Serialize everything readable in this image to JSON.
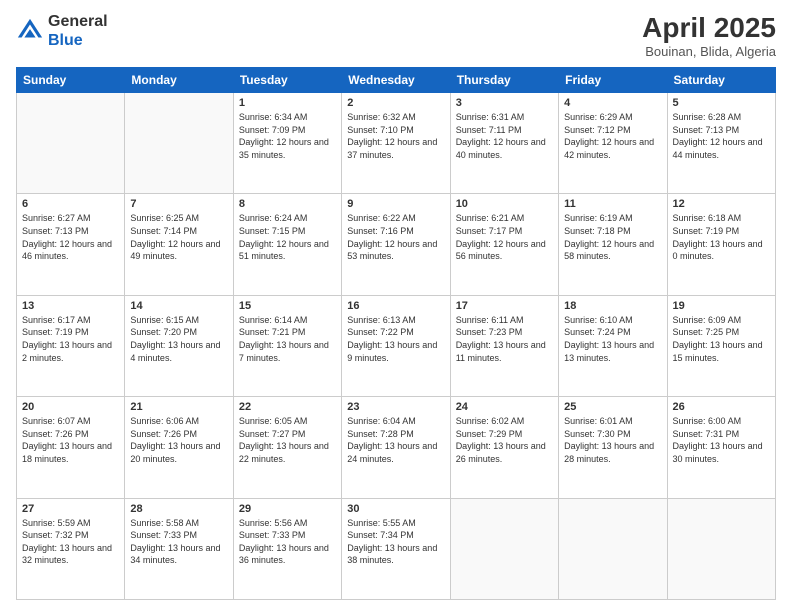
{
  "header": {
    "logo_line1": "General",
    "logo_line2": "Blue",
    "title": "April 2025",
    "subtitle": "Bouinan, Blida, Algeria"
  },
  "days_of_week": [
    "Sunday",
    "Monday",
    "Tuesday",
    "Wednesday",
    "Thursday",
    "Friday",
    "Saturday"
  ],
  "weeks": [
    [
      {
        "day": "",
        "info": ""
      },
      {
        "day": "",
        "info": ""
      },
      {
        "day": "1",
        "info": "Sunrise: 6:34 AM\nSunset: 7:09 PM\nDaylight: 12 hours and 35 minutes."
      },
      {
        "day": "2",
        "info": "Sunrise: 6:32 AM\nSunset: 7:10 PM\nDaylight: 12 hours and 37 minutes."
      },
      {
        "day": "3",
        "info": "Sunrise: 6:31 AM\nSunset: 7:11 PM\nDaylight: 12 hours and 40 minutes."
      },
      {
        "day": "4",
        "info": "Sunrise: 6:29 AM\nSunset: 7:12 PM\nDaylight: 12 hours and 42 minutes."
      },
      {
        "day": "5",
        "info": "Sunrise: 6:28 AM\nSunset: 7:13 PM\nDaylight: 12 hours and 44 minutes."
      }
    ],
    [
      {
        "day": "6",
        "info": "Sunrise: 6:27 AM\nSunset: 7:13 PM\nDaylight: 12 hours and 46 minutes."
      },
      {
        "day": "7",
        "info": "Sunrise: 6:25 AM\nSunset: 7:14 PM\nDaylight: 12 hours and 49 minutes."
      },
      {
        "day": "8",
        "info": "Sunrise: 6:24 AM\nSunset: 7:15 PM\nDaylight: 12 hours and 51 minutes."
      },
      {
        "day": "9",
        "info": "Sunrise: 6:22 AM\nSunset: 7:16 PM\nDaylight: 12 hours and 53 minutes."
      },
      {
        "day": "10",
        "info": "Sunrise: 6:21 AM\nSunset: 7:17 PM\nDaylight: 12 hours and 56 minutes."
      },
      {
        "day": "11",
        "info": "Sunrise: 6:19 AM\nSunset: 7:18 PM\nDaylight: 12 hours and 58 minutes."
      },
      {
        "day": "12",
        "info": "Sunrise: 6:18 AM\nSunset: 7:19 PM\nDaylight: 13 hours and 0 minutes."
      }
    ],
    [
      {
        "day": "13",
        "info": "Sunrise: 6:17 AM\nSunset: 7:19 PM\nDaylight: 13 hours and 2 minutes."
      },
      {
        "day": "14",
        "info": "Sunrise: 6:15 AM\nSunset: 7:20 PM\nDaylight: 13 hours and 4 minutes."
      },
      {
        "day": "15",
        "info": "Sunrise: 6:14 AM\nSunset: 7:21 PM\nDaylight: 13 hours and 7 minutes."
      },
      {
        "day": "16",
        "info": "Sunrise: 6:13 AM\nSunset: 7:22 PM\nDaylight: 13 hours and 9 minutes."
      },
      {
        "day": "17",
        "info": "Sunrise: 6:11 AM\nSunset: 7:23 PM\nDaylight: 13 hours and 11 minutes."
      },
      {
        "day": "18",
        "info": "Sunrise: 6:10 AM\nSunset: 7:24 PM\nDaylight: 13 hours and 13 minutes."
      },
      {
        "day": "19",
        "info": "Sunrise: 6:09 AM\nSunset: 7:25 PM\nDaylight: 13 hours and 15 minutes."
      }
    ],
    [
      {
        "day": "20",
        "info": "Sunrise: 6:07 AM\nSunset: 7:26 PM\nDaylight: 13 hours and 18 minutes."
      },
      {
        "day": "21",
        "info": "Sunrise: 6:06 AM\nSunset: 7:26 PM\nDaylight: 13 hours and 20 minutes."
      },
      {
        "day": "22",
        "info": "Sunrise: 6:05 AM\nSunset: 7:27 PM\nDaylight: 13 hours and 22 minutes."
      },
      {
        "day": "23",
        "info": "Sunrise: 6:04 AM\nSunset: 7:28 PM\nDaylight: 13 hours and 24 minutes."
      },
      {
        "day": "24",
        "info": "Sunrise: 6:02 AM\nSunset: 7:29 PM\nDaylight: 13 hours and 26 minutes."
      },
      {
        "day": "25",
        "info": "Sunrise: 6:01 AM\nSunset: 7:30 PM\nDaylight: 13 hours and 28 minutes."
      },
      {
        "day": "26",
        "info": "Sunrise: 6:00 AM\nSunset: 7:31 PM\nDaylight: 13 hours and 30 minutes."
      }
    ],
    [
      {
        "day": "27",
        "info": "Sunrise: 5:59 AM\nSunset: 7:32 PM\nDaylight: 13 hours and 32 minutes."
      },
      {
        "day": "28",
        "info": "Sunrise: 5:58 AM\nSunset: 7:33 PM\nDaylight: 13 hours and 34 minutes."
      },
      {
        "day": "29",
        "info": "Sunrise: 5:56 AM\nSunset: 7:33 PM\nDaylight: 13 hours and 36 minutes."
      },
      {
        "day": "30",
        "info": "Sunrise: 5:55 AM\nSunset: 7:34 PM\nDaylight: 13 hours and 38 minutes."
      },
      {
        "day": "",
        "info": ""
      },
      {
        "day": "",
        "info": ""
      },
      {
        "day": "",
        "info": ""
      }
    ]
  ]
}
